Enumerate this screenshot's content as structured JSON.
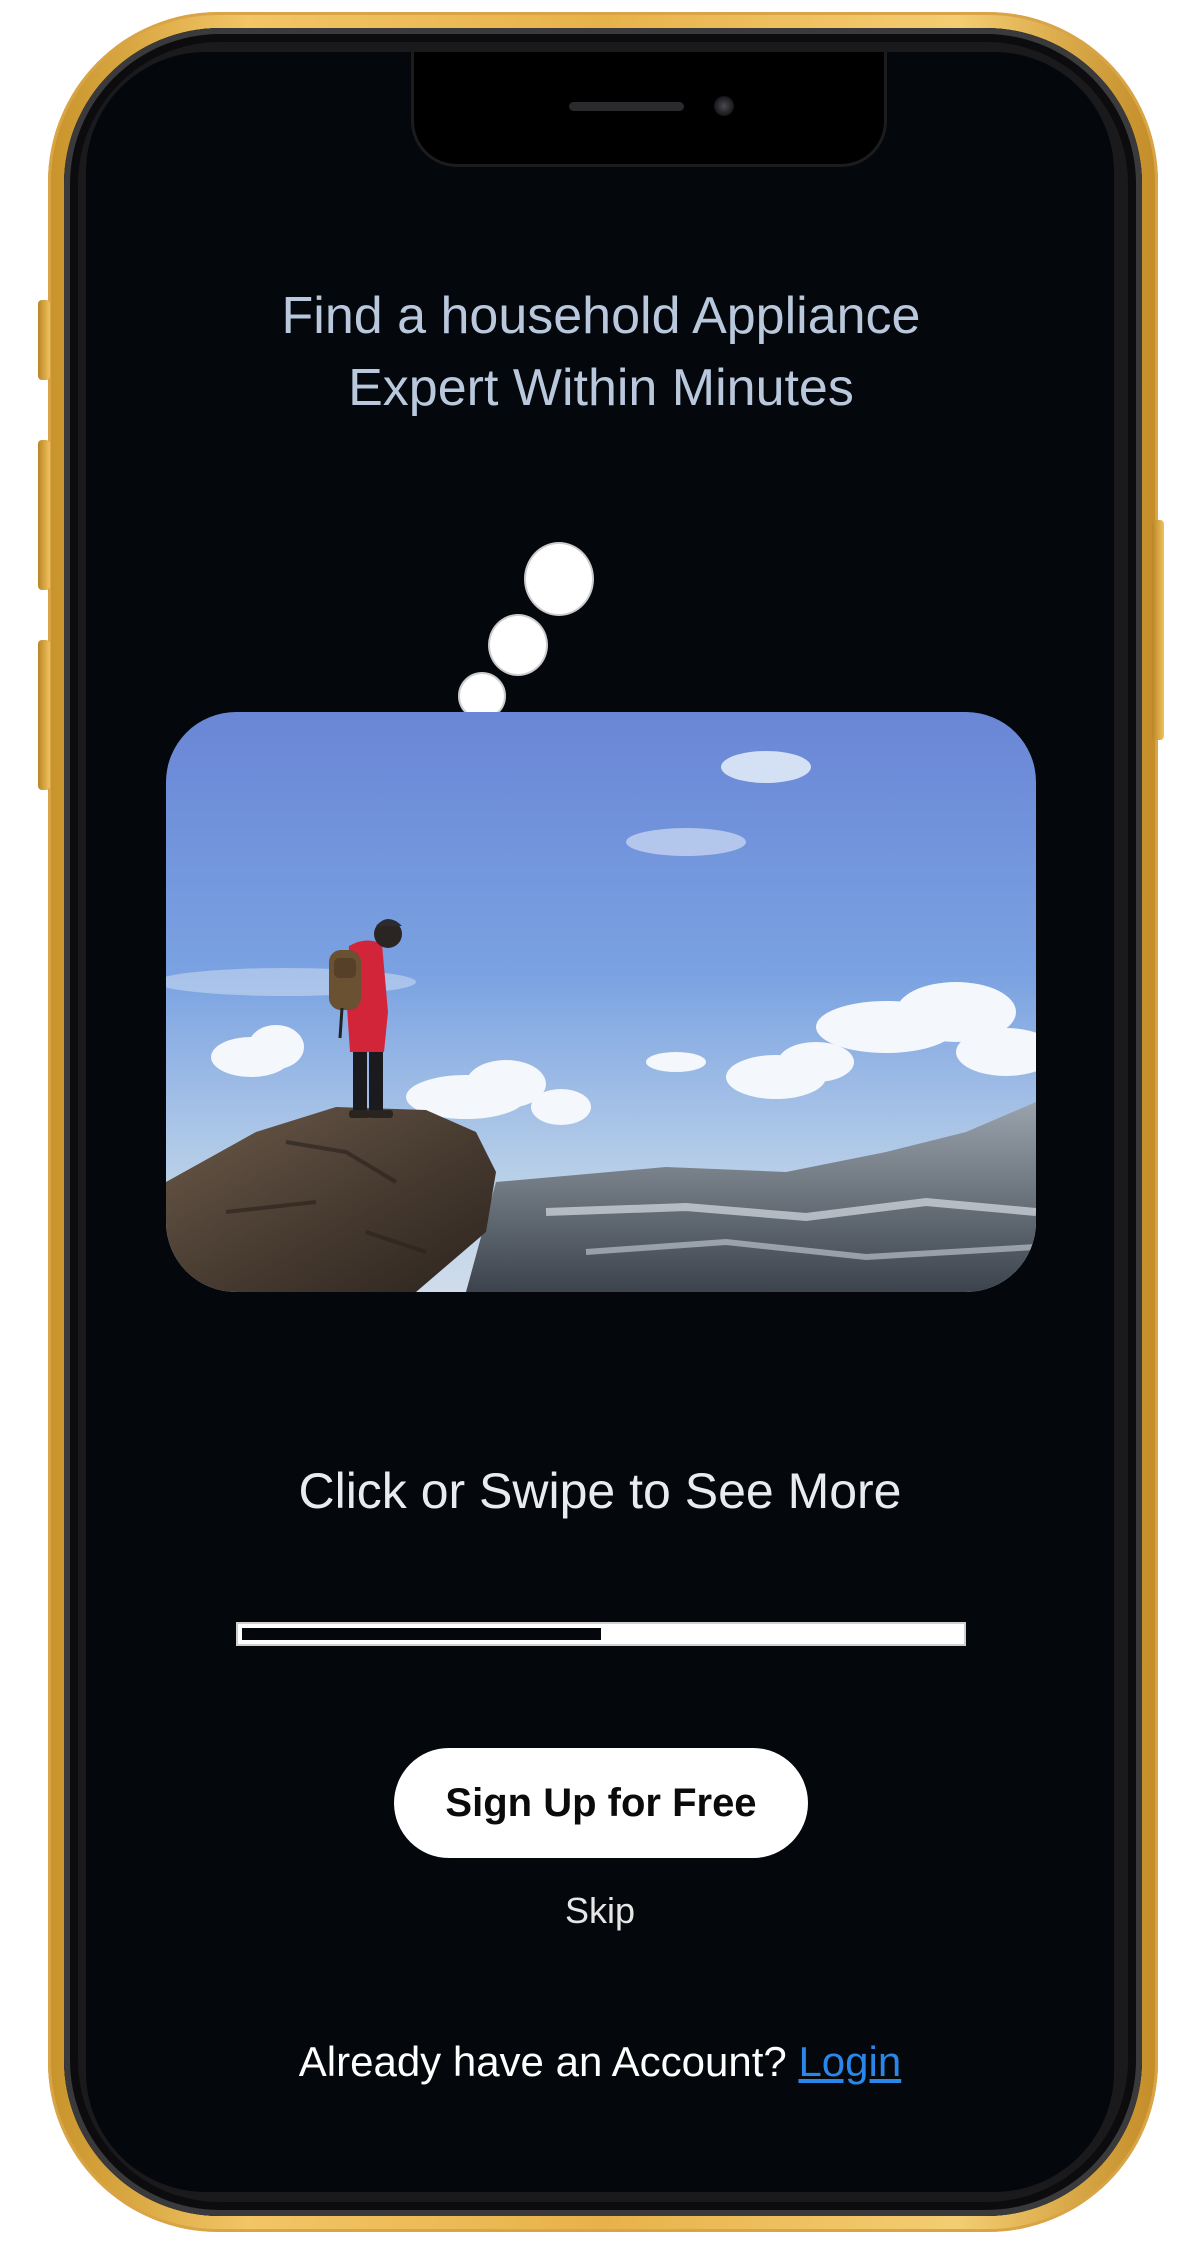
{
  "onboarding": {
    "headline": "Find a household Appliance Expert Within Minutes",
    "swipe_hint": "Click or Swipe to See More",
    "progress": 0.5,
    "signup_label": "Sign Up for Free",
    "skip_label": "Skip",
    "account_prompt": "Already have an Account?",
    "login_label": "Login"
  },
  "image": {
    "subject": "hiker-on-cliff-photo"
  },
  "colors": {
    "background": "#04070b",
    "headline": "#b9c8dc",
    "button": "#ffffff",
    "link": "#2a86e8",
    "frame": "#e8b24a"
  }
}
